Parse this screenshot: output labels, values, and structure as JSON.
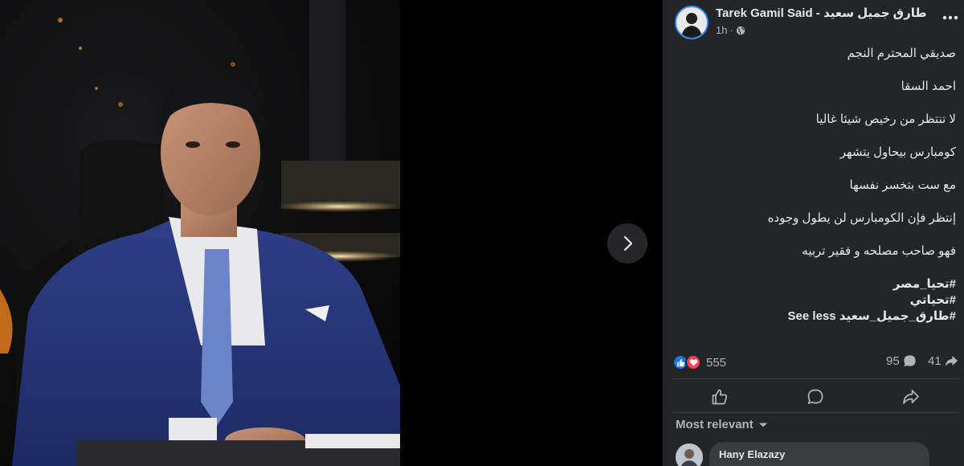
{
  "post": {
    "author": "Tarek Gamil Said - طارق جميل سعيد",
    "time": "1h",
    "paragraphs": [
      "صديقي المحترم النجم",
      "احمد السقا",
      "لا تنتظر من رخيص شيئا غاليا",
      "كومبارس بيحاول يتشهر",
      "مع ست بتخسر نفسها",
      "إنتظر فإن الكومبارس لن يطول وجوده",
      "فهو صاحب مصلحه و فقير تربيه"
    ],
    "hashtags": [
      "#تحيا_مصر",
      "#تحياتي",
      "#طارق_جميل_سعيد"
    ],
    "see_less": "See less"
  },
  "stats": {
    "reactions": "555",
    "comments": "95",
    "shares": "41"
  },
  "comments_section": {
    "sort_label": "Most relevant",
    "first_commenter": "Hany Elazazy"
  },
  "colors": {
    "panel_bg": "#242526",
    "accent": "#1b74e4",
    "love": "#f33e58"
  },
  "icons": [
    "more-options-icon",
    "globe-icon",
    "next-arrow-icon",
    "like-reaction-icon",
    "love-reaction-icon",
    "comment-icon",
    "share-icon",
    "like-button-icon",
    "comment-button-icon",
    "share-button-icon",
    "chevron-down-icon"
  ]
}
